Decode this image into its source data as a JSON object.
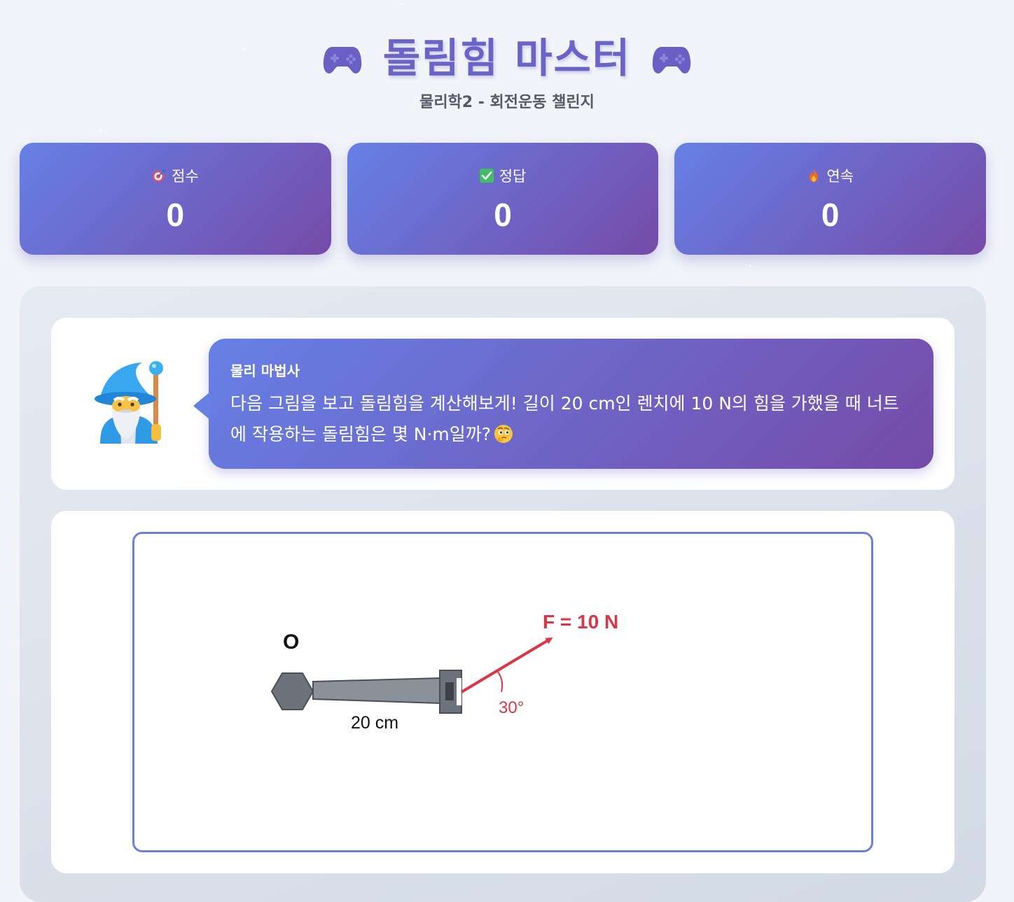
{
  "header": {
    "title": "돌림힘 마스터",
    "subtitle": "물리학2 - 회전운동 챌린지",
    "title_icon": "gamepad-icon"
  },
  "stats": [
    {
      "icon": "dart-icon",
      "label": "점수",
      "value": "0"
    },
    {
      "icon": "checkmark-icon",
      "label": "정답",
      "value": "0"
    },
    {
      "icon": "fire-icon",
      "label": "연속",
      "value": "0"
    }
  ],
  "dialog": {
    "avatar": "wizard-icon",
    "speaker": "물리 마법사",
    "question": "다음 그림을 보고 돌림힘을 계산해보게! 길이 20 cm인 렌치에 10 N의 힘을 가했을 때 너트에 작용하는 돌림힘은 몇 N·m일까?",
    "emoji": "thinking-face-icon"
  },
  "figure": {
    "pivot_label": "O",
    "length_label": "20 cm",
    "force_label": "F = 10 N",
    "angle_label": "30°",
    "accent_color": "#dc3545",
    "frame_color": "#6a7fe0"
  },
  "colors": {
    "gradient_start": "#6680e6",
    "gradient_end": "#764ba8",
    "title": "#6a63c8"
  }
}
